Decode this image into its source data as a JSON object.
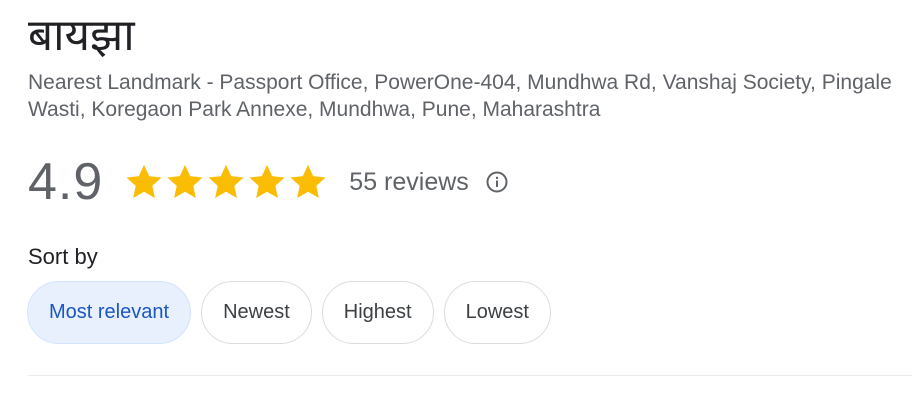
{
  "place": {
    "name": "बायझा",
    "address": "Nearest Landmark - Passport Office, PowerOne-404, Mundhwa Rd, Vanshaj Society, Pingale Wasti, Koregaon Park Annexe, Mundhwa, Pune, Maharashtra"
  },
  "rating": {
    "value": "4.9",
    "stars_filled": 5,
    "stars_total": 5,
    "reviews_label": "55 reviews",
    "info_icon": "info-circle-icon",
    "star_color": "#fbbc04"
  },
  "sort": {
    "label": "Sort by",
    "options": [
      {
        "label": "Most relevant",
        "selected": true
      },
      {
        "label": "Newest",
        "selected": false
      },
      {
        "label": "Highest",
        "selected": false
      },
      {
        "label": "Lowest",
        "selected": false
      }
    ]
  },
  "colors": {
    "selected_chip_bg": "#e8f0fe",
    "selected_chip_text": "#1a57c0"
  }
}
